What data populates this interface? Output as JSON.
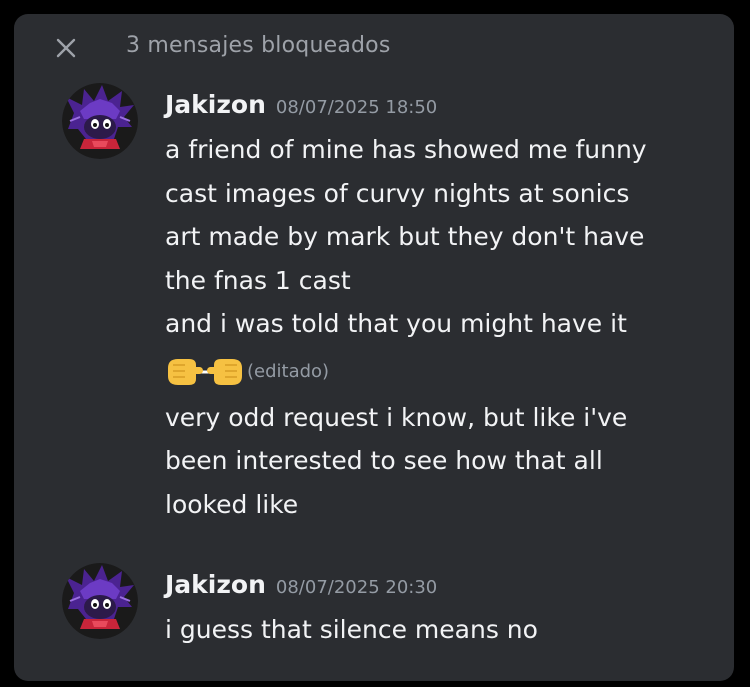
{
  "header": {
    "close_icon": "close-icon",
    "blocked_label": "3 mensajes bloqueados"
  },
  "messages": [
    {
      "author": "Jakizon",
      "timestamp": "08/07/2025 18:50",
      "lines": [
        "a friend of mine  has showed me funny",
        "cast images of curvy nights at sonics",
        "art made by mark but they don't have",
        "the fnas 1 cast",
        "and i was told that you might have it"
      ],
      "emoji": "pointing-hands-emoji",
      "edited": "(editado)",
      "lines_after": [
        "very odd request i know, but like i've",
        "been interested to see how that all",
        "looked like"
      ]
    },
    {
      "author": "Jakizon",
      "timestamp": "08/07/2025 20:30",
      "lines": [
        "i guess that silence means no"
      ]
    }
  ],
  "colors": {
    "background": "#000000",
    "panel": "#2b2d31",
    "text": "#f2f3f5",
    "muted": "#949ba4",
    "avatar_purple": "#5a2a9c",
    "avatar_red": "#c8253a"
  }
}
